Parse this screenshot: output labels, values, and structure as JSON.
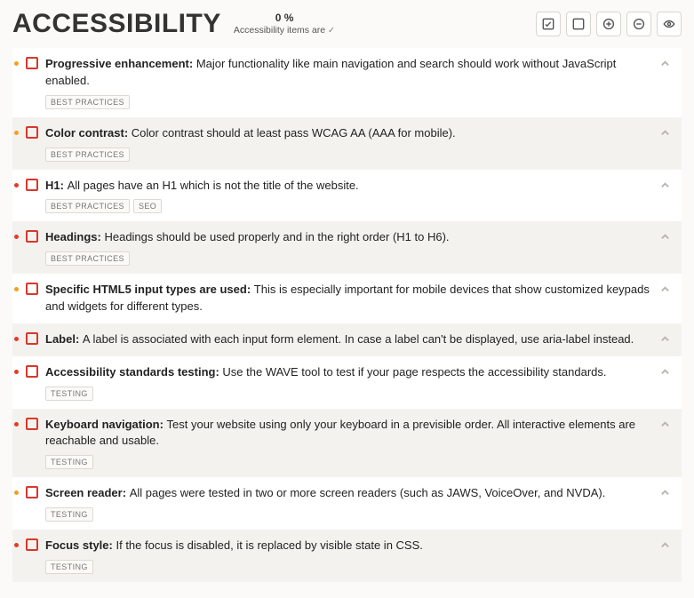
{
  "header": {
    "title": "ACCESSIBILITY",
    "progress_pct": "0 %",
    "progress_caption": "Accessibility items are"
  },
  "toolbar": {
    "check_all": "check-all",
    "uncheck_all": "uncheck-all",
    "expand_all": "expand-all",
    "collapse_all": "collapse-all",
    "toggle_visibility": "toggle-visibility"
  },
  "colors": {
    "priority_high": "#e43b2b",
    "priority_medium": "#f0a020",
    "checkbox_border": "#d9372b"
  },
  "tag_labels": {
    "best_practices": "BEST PRACTICES",
    "seo": "SEO",
    "testing": "TESTING"
  },
  "items": [
    {
      "priority": "amber",
      "title": "Progressive enhancement",
      "desc": "Major functionality like main navigation and search should work without JavaScript enabled.",
      "tags": [
        "best_practices"
      ]
    },
    {
      "priority": "amber",
      "title": "Color contrast",
      "desc": "Color contrast should at least pass WCAG AA (AAA for mobile).",
      "tags": [
        "best_practices"
      ]
    },
    {
      "priority": "red",
      "title": "H1",
      "desc": "All pages have an H1 which is not the title of the website.",
      "tags": [
        "best_practices",
        "seo"
      ]
    },
    {
      "priority": "red",
      "title": "Headings",
      "desc": "Headings should be used properly and in the right order (H1 to H6).",
      "tags": [
        "best_practices"
      ]
    },
    {
      "priority": "amber",
      "title": "Specific HTML5 input types are used",
      "desc": "This is especially important for mobile devices that show customized keypads and widgets for different types.",
      "tags": []
    },
    {
      "priority": "red",
      "title": "Label",
      "desc": "A label is associated with each input form element. In case a label can't be displayed, use aria-label instead.",
      "tags": []
    },
    {
      "priority": "red",
      "title": "Accessibility standards testing",
      "desc": "Use the WAVE tool to test if your page respects the accessibility standards.",
      "tags": [
        "testing"
      ]
    },
    {
      "priority": "red",
      "title": "Keyboard navigation",
      "desc": "Test your website using only your keyboard in a previsible order. All interactive elements are reachable and usable.",
      "tags": [
        "testing"
      ]
    },
    {
      "priority": "amber",
      "title": "Screen reader",
      "desc": "All pages were tested in two or more screen readers (such as JAWS, VoiceOver, and NVDA).",
      "tags": [
        "testing"
      ]
    },
    {
      "priority": "red",
      "title": "Focus style",
      "desc": "If the focus is disabled, it is replaced by visible state in CSS.",
      "tags": [
        "testing"
      ]
    }
  ]
}
